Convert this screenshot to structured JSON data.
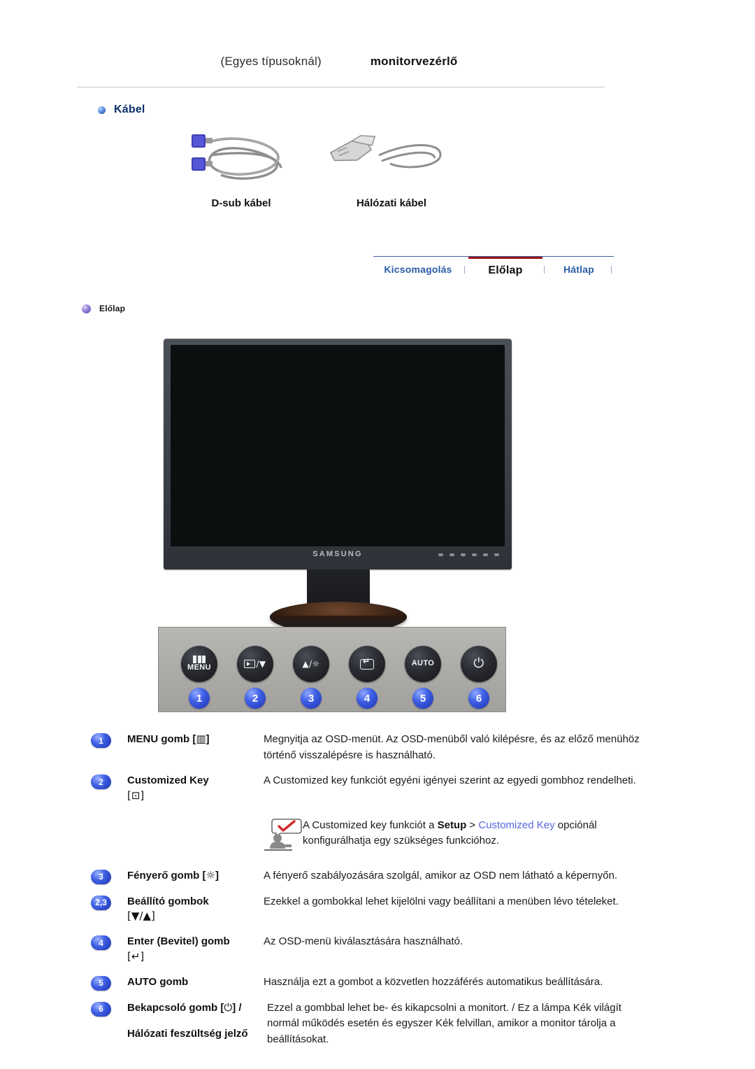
{
  "header": {
    "note": "(Egyes típusoknál)",
    "title": "monitorvezérlő"
  },
  "cable_section": {
    "heading": "Kábel",
    "items": [
      {
        "caption": "D-sub kábel",
        "icon": "dsub-cable-icon"
      },
      {
        "caption": "Hálózati kábel",
        "icon": "power-cable-icon"
      }
    ]
  },
  "tabs": [
    {
      "label": "Kicsomagolás",
      "active": false
    },
    {
      "label": "Előlap",
      "active": true
    },
    {
      "label": "Hátlap",
      "active": false
    }
  ],
  "front_section": {
    "heading": "Előlap",
    "monitor": {
      "brand": "SAMSUNG"
    },
    "control_panel": {
      "buttons": [
        {
          "number": "1",
          "label": "MENU",
          "icon": "menu-bars-icon"
        },
        {
          "number": "2",
          "label": "",
          "icon": "source-down-icon",
          "glyph": "/▼"
        },
        {
          "number": "3",
          "label": "",
          "icon": "up-brightness-icon",
          "glyph": "▲/☼"
        },
        {
          "number": "4",
          "label": "",
          "icon": "enter-icon"
        },
        {
          "number": "5",
          "label": "AUTO",
          "icon": "auto-icon"
        },
        {
          "number": "6",
          "label": "",
          "icon": "power-icon",
          "glyph": "⏻"
        }
      ]
    }
  },
  "descriptions": [
    {
      "badge": "1",
      "term": "MENU gomb [",
      "term_symbol": "▥",
      "term_suffix": "]",
      "definition": "Megnyitja az OSD-menüt. Az OSD-menüből való kilépésre, és az előző menühöz történő visszalépésre is használható."
    },
    {
      "badge": "2",
      "term": "Customized Key",
      "term_symbol": "[⊡]",
      "term_suffix": "",
      "definition": "A Customized key funkciót egyéni igényei szerint az egyedi gombhoz rendelheti."
    },
    {
      "badge": "3",
      "term": "Fényerő gomb [",
      "term_symbol": "☼",
      "term_suffix": "]",
      "definition": "A fényerő szabályozására szolgál, amikor az OSD nem látható a képernyőn."
    },
    {
      "badge": "2,3",
      "term": "Beállító gombok",
      "term_symbol": "[▼/▲]",
      "term_suffix": "",
      "definition": "Ezekkel a gombokkal lehet kijelölni vagy beállítani a menüben lévo tételeket."
    },
    {
      "badge": "4",
      "term": "Enter (Bevitel) gomb",
      "term_symbol": "[↵]",
      "term_suffix": "",
      "definition": "Az OSD-menü kiválasztására használható."
    },
    {
      "badge": "5",
      "term": "AUTO gomb",
      "term_symbol": "",
      "term_suffix": "",
      "definition": "Használja ezt a gombot a közvetlen hozzáférés automatikus beállítására."
    },
    {
      "badge": "6",
      "term": "Bekapcsoló gomb [",
      "term_symbol": "⏻",
      "term_suffix": "] /",
      "term_line2": "Hálózati feszültség jelző",
      "definition": "Ezzel a gombbal lehet be- és kikapcsolni a monitort. / Ez a lámpa Kék világít normál működés esetén és egyszer Kék felvillan, amikor a monitor tárolja a beállításokat."
    }
  ],
  "note": {
    "icon": "info-person-check-icon",
    "text_before": "A Customized key funkciót a ",
    "bold_1": "Setup",
    "text_mid": " > ",
    "link_1": "Customized Key",
    "text_after": " opciónál konfigurálhatja egy szükséges funkcióhoz."
  },
  "colors": {
    "accent_blue": "#3f5fe4",
    "tab_link": "#2a5ca8",
    "tab_active_bar": "#9c1216",
    "heading_blue": "#0b2f6b",
    "note_link": "#5566dd"
  }
}
